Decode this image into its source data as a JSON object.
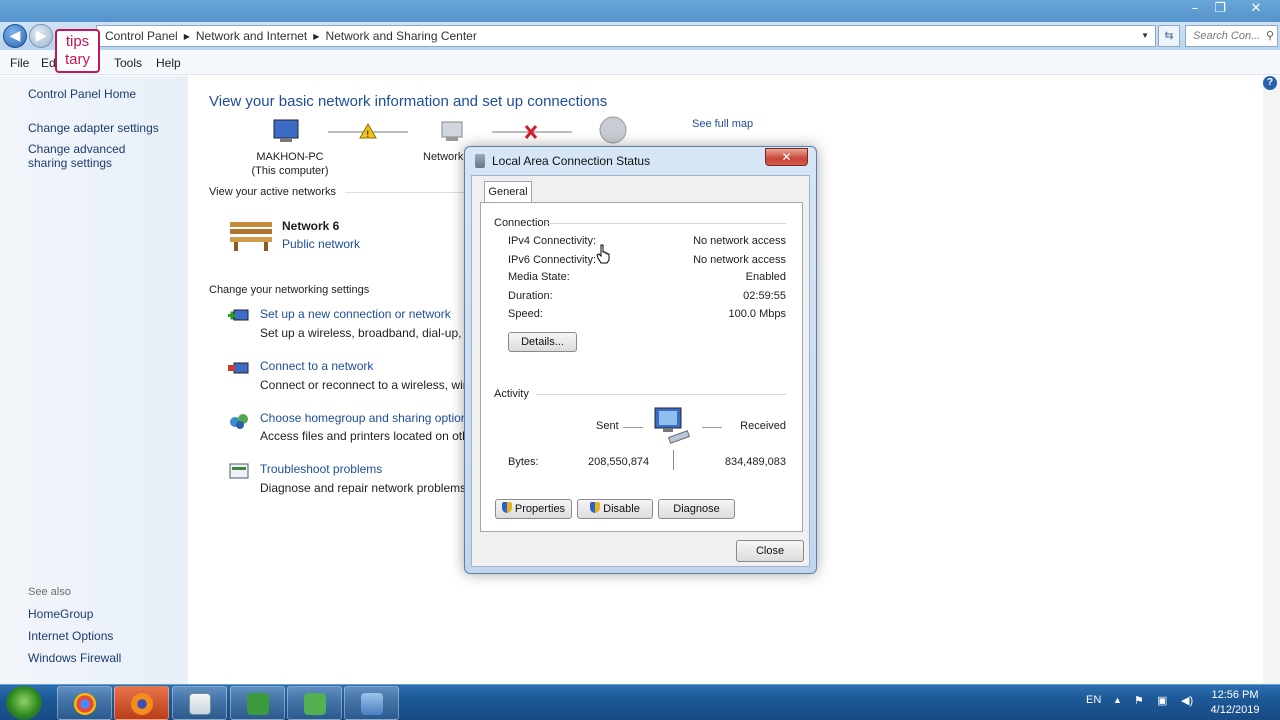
{
  "window": {
    "controls": {
      "minimize": "–",
      "restore": "❐",
      "close": "✕"
    }
  },
  "address": {
    "crumbs": [
      "Control Panel",
      "Network and Internet",
      "Network and Sharing Center"
    ],
    "search_placeholder": "Search Con..."
  },
  "logo": {
    "line1": "tips",
    "line2": "tary"
  },
  "menu": {
    "file": "File",
    "edit": "Ed",
    "tools": "Tools",
    "help": "Help"
  },
  "sidebar": {
    "home": "Control Panel Home",
    "change_adapter": "Change adapter settings",
    "change_advanced": "Change advanced sharing settings",
    "see_also": "See also",
    "homegroup": "HomeGroup",
    "internet_options": "Internet Options",
    "firewall": "Windows Firewall"
  },
  "main": {
    "title": "View your basic network information and set up connections",
    "see_full_map": "See full map",
    "computer_name": "MAKHON-PC",
    "computer_sub": "(This computer)",
    "network_label": "Network",
    "active_networks_heading": "View your active networks",
    "network_name": "Network 6",
    "network_type": "Public network",
    "change_settings_heading": "Change your networking settings",
    "tasks": [
      {
        "link": "Set up a new connection or network",
        "desc": "Set up a wireless, broadband, dial-up, ad"
      },
      {
        "link": "Connect to a network",
        "desc": "Connect or reconnect to a wireless, wired"
      },
      {
        "link": "Choose homegroup and sharing options",
        "desc": "Access files and printers located on other"
      },
      {
        "link": "Troubleshoot problems",
        "desc": "Diagnose and repair network problems, o"
      }
    ]
  },
  "dialog": {
    "title": "Local Area Connection Status",
    "tab": "General",
    "connection_heading": "Connection",
    "rows": [
      {
        "label": "IPv4 Connectivity:",
        "value": "No network access"
      },
      {
        "label": "IPv6 Connectivity:",
        "value": "No network access"
      },
      {
        "label": "Media State:",
        "value": "Enabled"
      },
      {
        "label": "Duration:",
        "value": "02:59:55"
      },
      {
        "label": "Speed:",
        "value": "100.0 Mbps"
      }
    ],
    "details_btn": "Details...",
    "activity_heading": "Activity",
    "sent_label": "Sent",
    "received_label": "Received",
    "bytes_label": "Bytes:",
    "bytes_sent": "208,550,874",
    "bytes_received": "834,489,083",
    "properties_btn": "Properties",
    "disable_btn": "Disable",
    "diagnose_btn": "Diagnose",
    "close_btn": "Close",
    "close_x": "✕"
  },
  "taskbar": {
    "language": "EN",
    "time": "12:56 PM",
    "date": "4/12/2019"
  },
  "colors": {
    "link": "#1e4e9a",
    "title_blue": "#1e4e9a",
    "taskbar": "#1d5896"
  }
}
